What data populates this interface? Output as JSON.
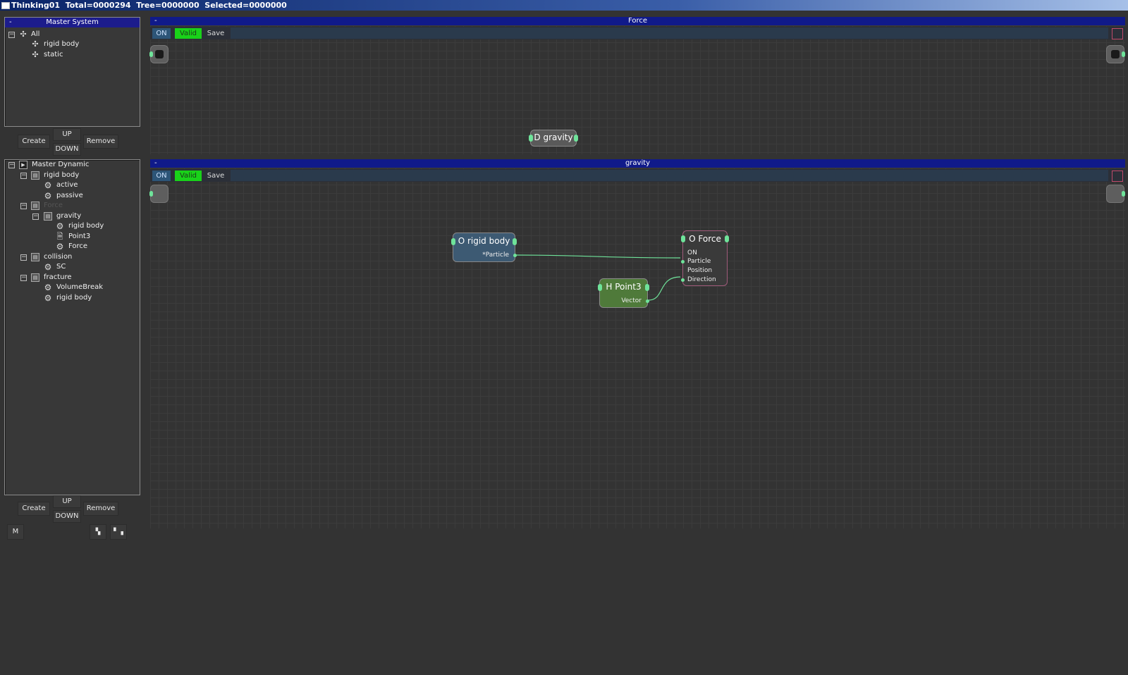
{
  "window": {
    "title": "Thinking01  Total=0000294  Tree=0000000  Selected=0000000"
  },
  "master_system": {
    "header": "Master System",
    "collapse": "-",
    "tree": [
      {
        "label": "All",
        "icon": "move-icon",
        "expander": "−"
      },
      {
        "label": "rigid body",
        "icon": "move-icon"
      },
      {
        "label": "static",
        "icon": "move-icon"
      }
    ],
    "buttons": {
      "create": "Create",
      "up": "UP",
      "down": "DOWN",
      "remove": "Remove"
    }
  },
  "master_dynamic": {
    "tree": [
      {
        "label": "Master Dynamic",
        "icon": "play-icon",
        "expander": "−"
      },
      {
        "label": "rigid body",
        "icon": "book-icon",
        "expander": "−"
      },
      {
        "label": "active",
        "icon": "gear-icon"
      },
      {
        "label": "passive",
        "icon": "gear-icon"
      },
      {
        "label": "Force",
        "icon": "book-icon",
        "expander": "−"
      },
      {
        "label": "gravity",
        "icon": "book-icon",
        "expander": "−"
      },
      {
        "label": "rigid body",
        "icon": "gear-icon"
      },
      {
        "label": "Point3",
        "icon": "doc-icon"
      },
      {
        "label": "Force",
        "icon": "gear-icon"
      },
      {
        "label": "collision",
        "icon": "book-icon",
        "expander": "−"
      },
      {
        "label": "SC",
        "icon": "gear-icon"
      },
      {
        "label": "fracture",
        "icon": "book-icon",
        "expander": "−"
      },
      {
        "label": "VolumeBreak",
        "icon": "gear-icon"
      },
      {
        "label": "rigid body",
        "icon": "gear-icon"
      }
    ],
    "buttons": {
      "create": "Create",
      "up": "UP",
      "down": "DOWN",
      "remove": "Remove",
      "m": "M"
    }
  },
  "force_editor": {
    "header": "Force",
    "collapse": "-",
    "toolbar": {
      "on": "ON",
      "valid": "Valid",
      "save": "Save"
    },
    "nodes": [
      {
        "title": "D gravity"
      }
    ]
  },
  "gravity_editor": {
    "header": "gravity",
    "collapse": "-",
    "toolbar": {
      "on": "ON",
      "valid": "Valid",
      "save": "Save"
    },
    "nodes": {
      "rigid_body": {
        "title": "O rigid body",
        "outputs": [
          "*Particle"
        ],
        "color": "#3d5a73"
      },
      "force": {
        "title": "O Force",
        "inputs": [
          "ON",
          "Particle",
          "Position",
          "Direction"
        ],
        "color": "#3a3a3a"
      },
      "point3": {
        "title": "H Point3",
        "outputs": [
          "Vector"
        ],
        "color": "#4f7a3a"
      }
    }
  },
  "colors": {
    "header_blue": "#1c1c8c",
    "valid_green": "#19d219",
    "pin_green": "#6fe39a",
    "background": "#333333"
  }
}
